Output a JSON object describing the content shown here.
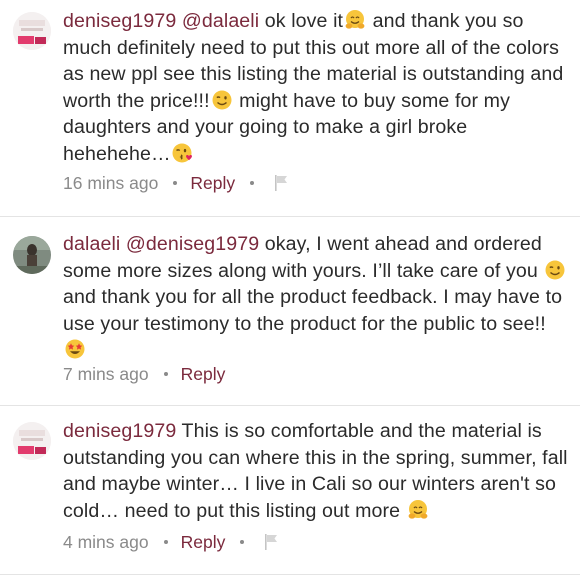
{
  "comments": [
    {
      "username": "deniseg1979",
      "mention": "@dalaeli",
      "text_parts": [
        " ok love it",
        " and thank you so much definitely need to put this out more all of the colors as new ppl see this listing the material is outstanding and worth the price!!!",
        " might have to buy some for my daughters and your going to make a girl broke hehehehe…"
      ],
      "emojis": [
        "hugging-face-emoji",
        "winking-face-emoji",
        "face-blowing-kiss-emoji"
      ],
      "time": "16 mins ago",
      "reply_label": "Reply",
      "flag_icon": "flag-icon"
    },
    {
      "username": "dalaeli",
      "mention": "@deniseg1979",
      "text_parts": [
        " okay, I went ahead and ordered some more sizes along with yours. I’ll take care of you ",
        " and thank you for all the product feedback. I may have to use your testimony to the product for the public to see!! "
      ],
      "emojis": [
        "winking-face-emoji",
        "star-struck-emoji"
      ],
      "time": "7 mins ago",
      "reply_label": "Reply"
    },
    {
      "username": "deniseg1979",
      "text_parts": [
        "  This is so comfortable and the material is outstanding you can where this in the spring, summer, fall and maybe winter… I live in Cali so our winters aren't so cold… need to put this listing out more "
      ],
      "emojis": [
        "hugging-face-emoji"
      ],
      "time": "4 mins ago",
      "reply_label": "Reply",
      "flag_icon": "flag-icon"
    }
  ],
  "colors": {
    "accent": "#7b2a3d",
    "text": "#2b2b2b",
    "meta": "#8a8a8a",
    "divider": "#e4e4e4"
  }
}
